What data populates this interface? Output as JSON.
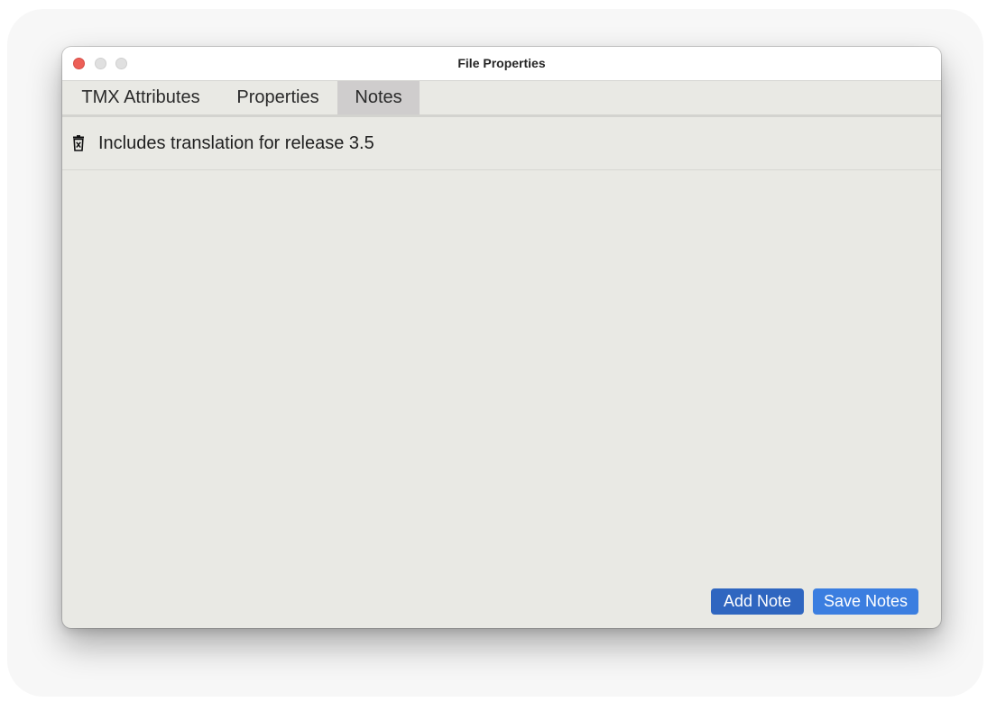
{
  "window": {
    "title": "File Properties"
  },
  "tabs": [
    {
      "label": "TMX Attributes",
      "active": false
    },
    {
      "label": "Properties",
      "active": false
    },
    {
      "label": "Notes",
      "active": true
    }
  ],
  "notes": [
    {
      "text": "Includes translation for release 3.5",
      "icon": "trash-icon"
    }
  ],
  "buttons": {
    "add_note": "Add Note",
    "save_notes": "Save Notes"
  },
  "colors": {
    "close_button": "#ed5f57",
    "primary_button": "#2f66c0",
    "secondary_button": "#3b7ee0",
    "active_tab": "#cfcdcd",
    "panel_background": "#e9e9e4"
  }
}
